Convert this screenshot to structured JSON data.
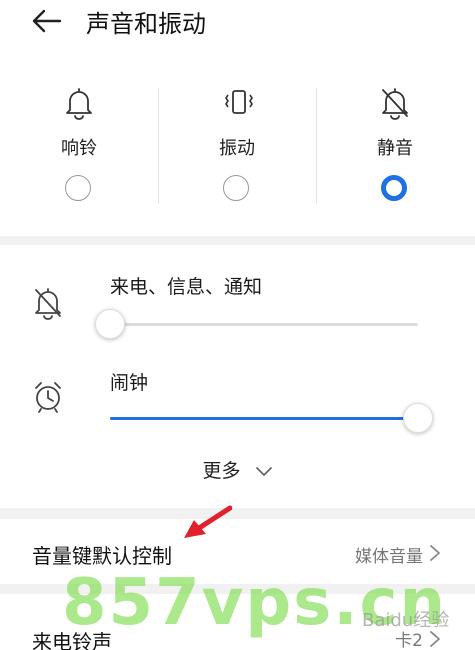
{
  "header": {
    "title": "声音和振动"
  },
  "modes": [
    {
      "label": "响铃",
      "icon": "bell-icon",
      "selected": false
    },
    {
      "label": "振动",
      "icon": "vibrate-icon",
      "selected": false
    },
    {
      "label": "静音",
      "icon": "bell-muted-icon",
      "selected": true
    }
  ],
  "volumes": [
    {
      "label": "来电、信息、通知",
      "icon": "bell-muted-icon",
      "level": 0.0
    },
    {
      "label": "闹钟",
      "icon": "alarm-clock-icon",
      "level": 1.0
    }
  ],
  "more": {
    "label": "更多"
  },
  "settings": [
    {
      "title": "音量键默认控制",
      "value": "媒体音量"
    },
    {
      "title": "来电铃声",
      "value": "卡2"
    }
  ],
  "watermark": {
    "text": "857vps.cn",
    "brand": "Baidu经验"
  },
  "colors": {
    "accent": "#1f6fe5",
    "annotation": "#e0202a",
    "band": "#f1f1f1"
  }
}
